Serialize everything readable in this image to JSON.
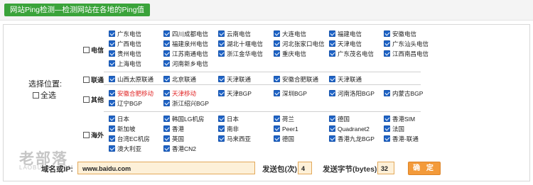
{
  "title": "网站Ping检测—检测网站在各地的Ping值",
  "select_position": "选择位置:",
  "select_all": "全选",
  "groups": {
    "telecom": "电信",
    "unicom": "联通",
    "others": "其他",
    "overseas": "海外"
  },
  "telecom_items": [
    "广东电信",
    "四川成都电信",
    "云南电信",
    "大连电信",
    "福建电信",
    "安徽电信",
    "广西电信",
    "福建泉州电信",
    "湖北十堰电信",
    "河北张家口电信",
    "天津电信",
    "广东汕头电信",
    "贵州电信",
    "江苏南通电信",
    "浙江金华电信",
    "重庆电信",
    "广东茂名电信",
    "江西南昌电信",
    "上海电信",
    "河南新乡电信"
  ],
  "unicom_items": [
    "山西太原联通",
    "北京联通",
    "天津联通",
    "安徽合肥联通",
    "天津联通"
  ],
  "other_items": [
    {
      "label": "安徽合肥移动",
      "red": true
    },
    {
      "label": "天津移动",
      "red": true
    },
    {
      "label": "天津BGP",
      "red": false
    },
    {
      "label": "深圳BGP",
      "red": false
    },
    {
      "label": "河南洛阳BGP",
      "red": false
    },
    {
      "label": "内蒙古BGP",
      "red": false
    },
    {
      "label": "辽宁BGP",
      "red": false
    },
    {
      "label": "浙江绍兴BGP",
      "red": false
    }
  ],
  "overseas_items": [
    "日本",
    "韩国LG机房",
    "日本",
    "荷兰",
    "德国",
    "香港SIM",
    "新加坡",
    "香港",
    "南非",
    "Peer1",
    "Quadranet2",
    "法国",
    "台湾EC机房",
    "英国",
    "马来西亚",
    "德国",
    "香港九龙BGP",
    "香港-联通",
    "澳大利亚",
    "香港CN2"
  ],
  "form": {
    "domain_label": "域名或IP:",
    "domain_value": "www.baidu.com",
    "packets_label": "发送包(次):",
    "packets_value": "4",
    "bytes_label": "发送字节(bytes):",
    "bytes_value": "32",
    "submit_label": "确 定"
  },
  "watermark": {
    "text": "老部落",
    "sub": "LAOBULUO.COM"
  },
  "colors": {
    "title_bg": "#3aa33a",
    "checkbox": "#1e63c6",
    "red_text": "#e02020",
    "button": "#f39a3a",
    "input_bg": "#fdf0d8"
  }
}
